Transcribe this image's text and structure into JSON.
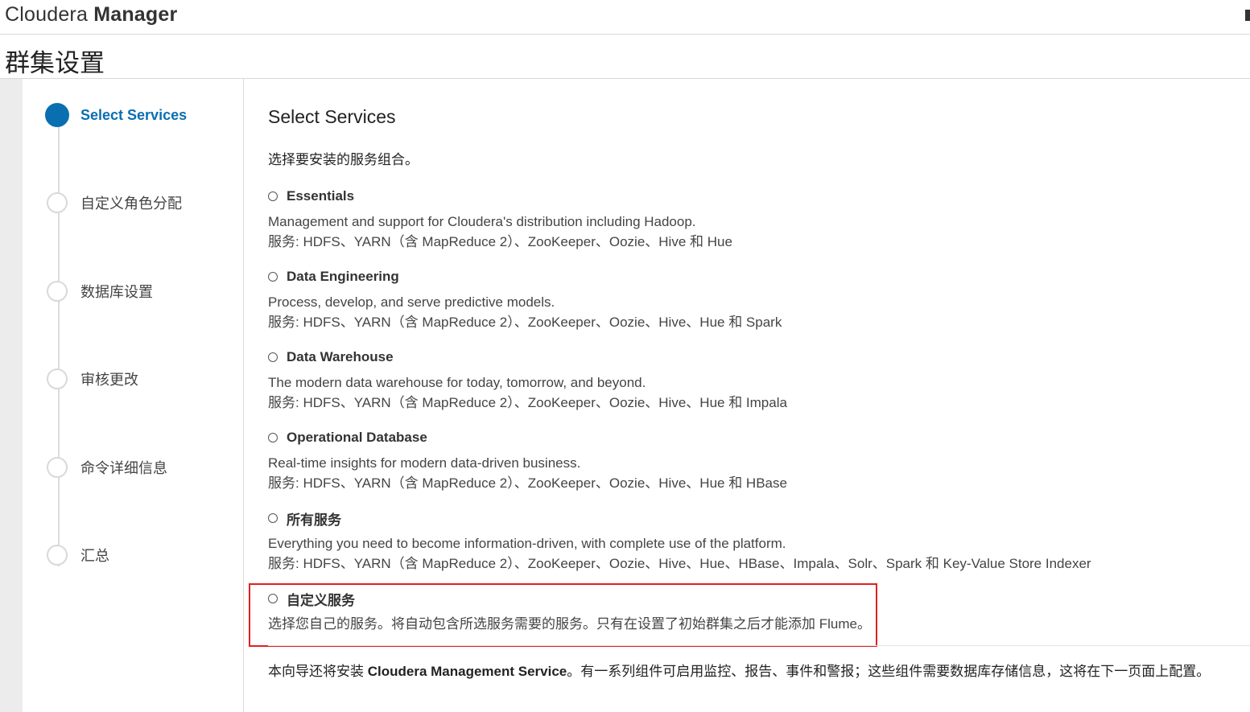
{
  "header": {
    "brand_light": "Cloudera ",
    "brand_bold": "Manager"
  },
  "page": {
    "title": "群集设置"
  },
  "wizard": {
    "steps": [
      {
        "label": "Select Services",
        "active": true
      },
      {
        "label": "自定义角色分配",
        "active": false
      },
      {
        "label": "数据库设置",
        "active": false
      },
      {
        "label": "审核更改",
        "active": false
      },
      {
        "label": "命令详细信息",
        "active": false
      },
      {
        "label": "汇总",
        "active": false
      }
    ]
  },
  "main": {
    "section_title": "Select Services",
    "intro": "选择要安装的服务组合。",
    "options": [
      {
        "name": "Essentials",
        "desc": "Management and support for Cloudera's distribution including Hadoop.",
        "services": "服务: HDFS、YARN（含 MapReduce 2）、ZooKeeper、Oozie、Hive 和 Hue"
      },
      {
        "name": "Data Engineering",
        "desc": "Process, develop, and serve predictive models.",
        "services": "服务: HDFS、YARN（含 MapReduce 2）、ZooKeeper、Oozie、Hive、Hue 和 Spark"
      },
      {
        "name": "Data Warehouse",
        "desc": "The modern data warehouse for today, tomorrow, and beyond.",
        "services": "服务: HDFS、YARN（含 MapReduce 2）、ZooKeeper、Oozie、Hive、Hue 和 Impala"
      },
      {
        "name": "Operational Database",
        "desc": "Real-time insights for modern data-driven business.",
        "services": "服务: HDFS、YARN（含 MapReduce 2）、ZooKeeper、Oozie、Hive、Hue 和 HBase"
      },
      {
        "name": "所有服务",
        "desc": "Everything you need to become information-driven, with complete use of the platform.",
        "services": "服务: HDFS、YARN（含 MapReduce 2）、ZooKeeper、Oozie、Hive、Hue、HBase、Impala、Solr、Spark 和 Key-Value Store Indexer"
      },
      {
        "name": "自定义服务",
        "desc": "选择您自己的服务。将自动包含所选服务需要的服务。只有在设置了初始群集之后才能添加 Flume。",
        "services": ""
      }
    ],
    "footnote_prefix": "本向导还将安装 ",
    "footnote_bold": "Cloudera Management Service",
    "footnote_suffix": "。有一系列组件可启用监控、报告、事件和警报；这些组件需要数据库存储信息，这将在下一页面上配置。"
  },
  "colors": {
    "accent": "#0a6fb0",
    "highlight": "#e02020"
  }
}
